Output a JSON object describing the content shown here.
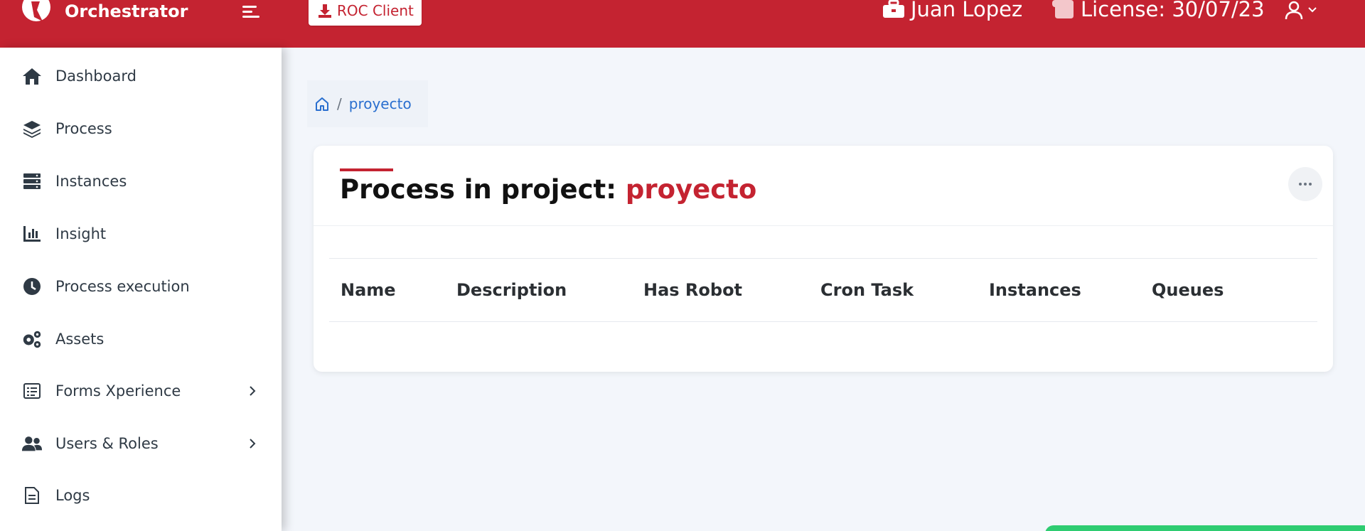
{
  "app": {
    "name": "Orchestrator"
  },
  "topbar": {
    "roc_button_label": "ROC Client",
    "user_name": "Juan Lopez",
    "license_text": "License: 30/07/23"
  },
  "sidebar": {
    "items": [
      {
        "label": "Dashboard",
        "icon": "home-icon"
      },
      {
        "label": "Process",
        "icon": "layers-icon"
      },
      {
        "label": "Instances",
        "icon": "server-icon"
      },
      {
        "label": "Insight",
        "icon": "bar-chart-icon"
      },
      {
        "label": "Process execution",
        "icon": "clock-icon"
      },
      {
        "label": "Assets",
        "icon": "gears-icon"
      },
      {
        "label": "Forms Xperience",
        "icon": "form-list-icon",
        "has_submenu": true
      },
      {
        "label": "Users & Roles",
        "icon": "users-icon",
        "has_submenu": true
      },
      {
        "label": "Logs",
        "icon": "document-icon"
      }
    ]
  },
  "breadcrumb": {
    "separator": "/",
    "current": "proyecto"
  },
  "card": {
    "title_prefix": "Process in project: ",
    "title_project": "proyecto",
    "columns": [
      "Name",
      "Description",
      "Has Robot",
      "Cron Task",
      "Instances",
      "Queues"
    ]
  },
  "colors": {
    "brand": "#c42331",
    "link": "#2a6fcf",
    "toast": "#2ecc71"
  }
}
